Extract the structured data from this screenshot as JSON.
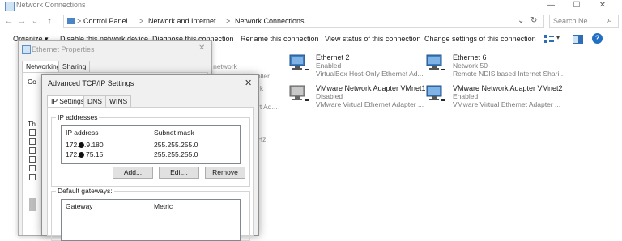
{
  "window": {
    "title": "Network Connections",
    "minimize": "—",
    "maximize": "☐",
    "close": "✕"
  },
  "nav": {
    "back": "←",
    "forward": "→",
    "down": "⌄",
    "up": "↑",
    "refresh": "↻",
    "dropdown": "⌄"
  },
  "breadcrumb": [
    "Control Panel",
    "Network and Internet",
    "Network Connections"
  ],
  "breadcrumb_sep": ">",
  "search": {
    "placeholder": "Search Ne...",
    "glyph": "⌕"
  },
  "commands": {
    "organize": "Organize ▾",
    "disable": "Disable this network device",
    "diagnose": "Diagnose this connection",
    "rename": "Rename this connection",
    "view_status": "View status of this connection",
    "change_settings": "Change settings of this connection",
    "help": "?"
  },
  "adapters": [
    {
      "name": "Ethernet 2",
      "status": "Enabled",
      "desc": "VirtualBox Host-Only Ethernet Ad..."
    },
    {
      "name": "Ethernet 6",
      "status": "Network 50",
      "desc": "Remote NDIS based Internet Shari..."
    },
    {
      "name": "VMware Network Adapter VMnet1",
      "status": "Disabled",
      "desc": "VMware Virtual Ethernet Adapter ..."
    },
    {
      "name": "VMware Network Adapter VMnet2",
      "status": "Enabled",
      "desc": "VMware Virtual Ethernet Adapter ..."
    }
  ],
  "background_fragments": {
    "line1": "d network",
    "line2": "bE Family Controller",
    "line3": "rk",
    "line4": "rt Ad...",
    "line5": "Hz"
  },
  "eth_dialog": {
    "title": "Ethernet Properties",
    "close": "✕",
    "tabs": [
      "Networking",
      "Sharing"
    ],
    "fragment_co": "Co",
    "fragment_th": "Th"
  },
  "adv_dialog": {
    "title": "Advanced TCP/IP Settings",
    "close": "✕",
    "tabs": [
      "IP Settings",
      "DNS",
      "WINS"
    ],
    "ip_group": {
      "label": "IP addresses",
      "col_ip": "IP address",
      "col_mask": "Subnet mask",
      "rows": [
        {
          "ip_prefix": "172.",
          "ip_suffix": ".9.180",
          "mask": "255.255.255.0"
        },
        {
          "ip_prefix": "172.",
          "ip_suffix": "75.15",
          "mask": "255.255.255.0"
        }
      ],
      "buttons": {
        "add": "Add...",
        "edit": "Edit...",
        "remove": "Remove"
      }
    },
    "gw_group": {
      "label": "Default gateways:",
      "col_gateway": "Gateway",
      "col_metric": "Metric"
    }
  },
  "colors": {
    "accent": "#0a62c4",
    "window_bg": "#f0f0f0",
    "nic_blue": "#3f7fc1"
  }
}
